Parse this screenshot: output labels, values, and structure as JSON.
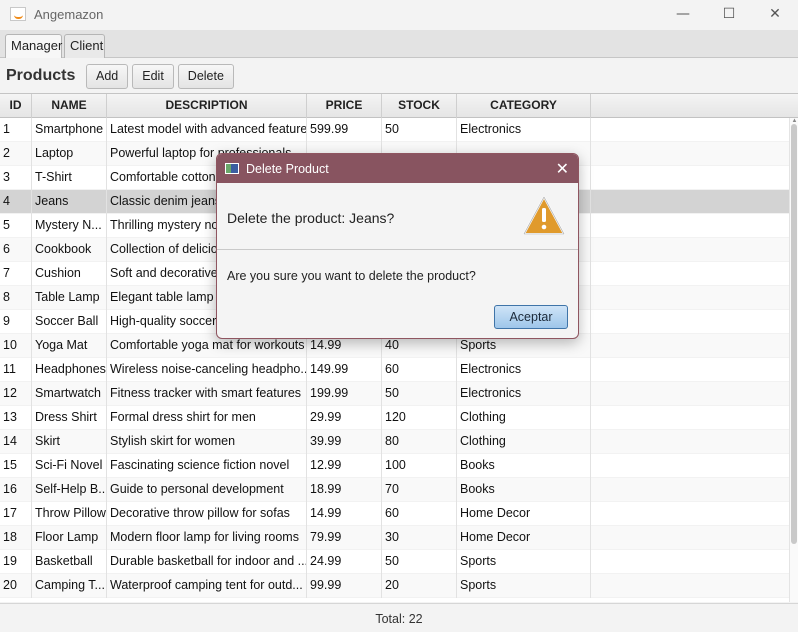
{
  "window": {
    "title": "Angemazon",
    "controls": {
      "minimize": "—",
      "maximize": "☐",
      "close": "✕"
    }
  },
  "tabs": [
    "Manager",
    "Client"
  ],
  "toolbar": {
    "title": "Products",
    "add_label": "Add",
    "edit_label": "Edit",
    "delete_label": "Delete"
  },
  "table": {
    "columns": [
      "ID",
      "NAME",
      "DESCRIPTION",
      "PRICE",
      "STOCK",
      "CATEGORY"
    ],
    "rows": [
      [
        "1",
        "Smartphone",
        "Latest model with advanced features",
        "599.99",
        "50",
        "Electronics"
      ],
      [
        "2",
        "Laptop",
        "Powerful laptop for professionals",
        "",
        "",
        ""
      ],
      [
        "3",
        "T-Shirt",
        "Comfortable cotton t-shirt",
        "",
        "",
        ""
      ],
      [
        "4",
        "Jeans",
        "Classic denim jeans",
        "",
        "",
        ""
      ],
      [
        "5",
        "Mystery N...",
        "Thrilling mystery novel",
        "",
        "",
        ""
      ],
      [
        "6",
        "Cookbook",
        "Collection of delicious recipes",
        "",
        "",
        ""
      ],
      [
        "7",
        "Cushion",
        "Soft and decorative cushion",
        "",
        "",
        ""
      ],
      [
        "8",
        "Table Lamp",
        "Elegant table lamp",
        "",
        "",
        ""
      ],
      [
        "9",
        "Soccer Ball",
        "High-quality soccer ball",
        "",
        "",
        ""
      ],
      [
        "10",
        "Yoga Mat",
        "Comfortable yoga mat for workouts",
        "14.99",
        "40",
        "Sports"
      ],
      [
        "11",
        "Headphones",
        "Wireless noise-canceling headpho...",
        "149.99",
        "60",
        "Electronics"
      ],
      [
        "12",
        "Smartwatch",
        "Fitness tracker with smart features",
        "199.99",
        "50",
        "Electronics"
      ],
      [
        "13",
        "Dress Shirt",
        "Formal dress shirt for men",
        "29.99",
        "120",
        "Clothing"
      ],
      [
        "14",
        "Skirt",
        "Stylish skirt for women",
        "39.99",
        "80",
        "Clothing"
      ],
      [
        "15",
        "Sci-Fi Novel",
        "Fascinating science fiction novel",
        "12.99",
        "100",
        "Books"
      ],
      [
        "16",
        "Self-Help B...",
        "Guide to personal development",
        "18.99",
        "70",
        "Books"
      ],
      [
        "17",
        "Throw Pillow",
        "Decorative throw pillow for sofas",
        "14.99",
        "60",
        "Home Decor"
      ],
      [
        "18",
        "Floor Lamp",
        "Modern floor lamp for living rooms",
        "79.99",
        "30",
        "Home Decor"
      ],
      [
        "19",
        "Basketball",
        "Durable basketball for indoor and ...",
        "24.99",
        "50",
        "Sports"
      ],
      [
        "20",
        "Camping T...",
        "Waterproof camping tent for outd...",
        "99.99",
        "20",
        "Sports"
      ]
    ],
    "selected_row_id": "4"
  },
  "footer": {
    "total_text": "Total: 22"
  },
  "dialog": {
    "title": "Delete Product",
    "header_text": "Delete the product: Jeans?",
    "content_text": "Are you sure you want to delete the product?",
    "ok_label": "Aceptar",
    "warning_icon": "warning-icon",
    "titlebar_color": "#885460"
  }
}
